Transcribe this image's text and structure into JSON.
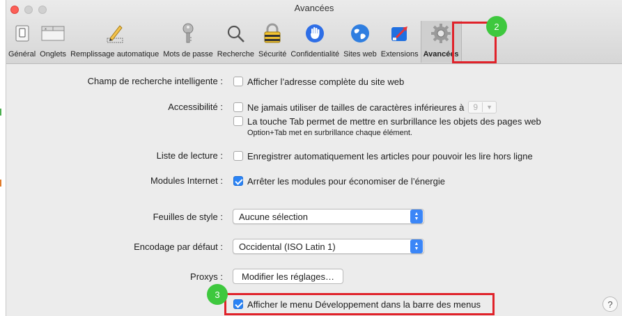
{
  "window": {
    "title": "Avancées"
  },
  "toolbar": {
    "items": [
      {
        "label": "Général",
        "icon": "switch-icon"
      },
      {
        "label": "Onglets",
        "icon": "tabs-icon"
      },
      {
        "label": "Remplissage automatique",
        "icon": "pencil-icon"
      },
      {
        "label": "Mots de passe",
        "icon": "key-icon"
      },
      {
        "label": "Recherche",
        "icon": "magnifier-icon"
      },
      {
        "label": "Sécurité",
        "icon": "padlock-icon"
      },
      {
        "label": "Confidentialité",
        "icon": "hand-icon"
      },
      {
        "label": "Sites web",
        "icon": "globe-icon"
      },
      {
        "label": "Extensions",
        "icon": "puzzle-icon"
      },
      {
        "label": "Avancées",
        "icon": "gear-icon"
      }
    ],
    "selected": "Avancées"
  },
  "badges": {
    "step2": "2",
    "step3": "3"
  },
  "settings": {
    "smart_search_label": "Champ de recherche intelligente :",
    "smart_search_option": "Afficher l’adresse complète du site web",
    "accessibility_label": "Accessibilité :",
    "accessibility_option1": "Ne jamais utiliser de tailles de caractères inférieures à",
    "font_size_value": "9",
    "accessibility_option2": "La touche Tab permet de mettre en surbrillance les objets des pages web",
    "accessibility_note": "Option+Tab met en surbrillance chaque élément.",
    "reading_list_label": "Liste de lecture :",
    "reading_list_option": "Enregistrer automatiquement les articles pour pouvoir les lire hors ligne",
    "plugins_label": "Modules Internet :",
    "plugins_option": "Arrêter les modules pour économiser de l’énergie",
    "stylesheet_label": "Feuilles de style :",
    "stylesheet_value": "Aucune sélection",
    "encoding_label": "Encodage par défaut :",
    "encoding_value": "Occidental (ISO Latin 1)",
    "proxies_label": "Proxys :",
    "proxies_button": "Modifier les réglages…",
    "develop_option": "Afficher le menu Développement dans la barre des menus"
  },
  "help": {
    "label": "?"
  },
  "colors": {
    "highlight": "#e0222a",
    "badge": "#3ec83e",
    "accent": "#2a83f5"
  }
}
